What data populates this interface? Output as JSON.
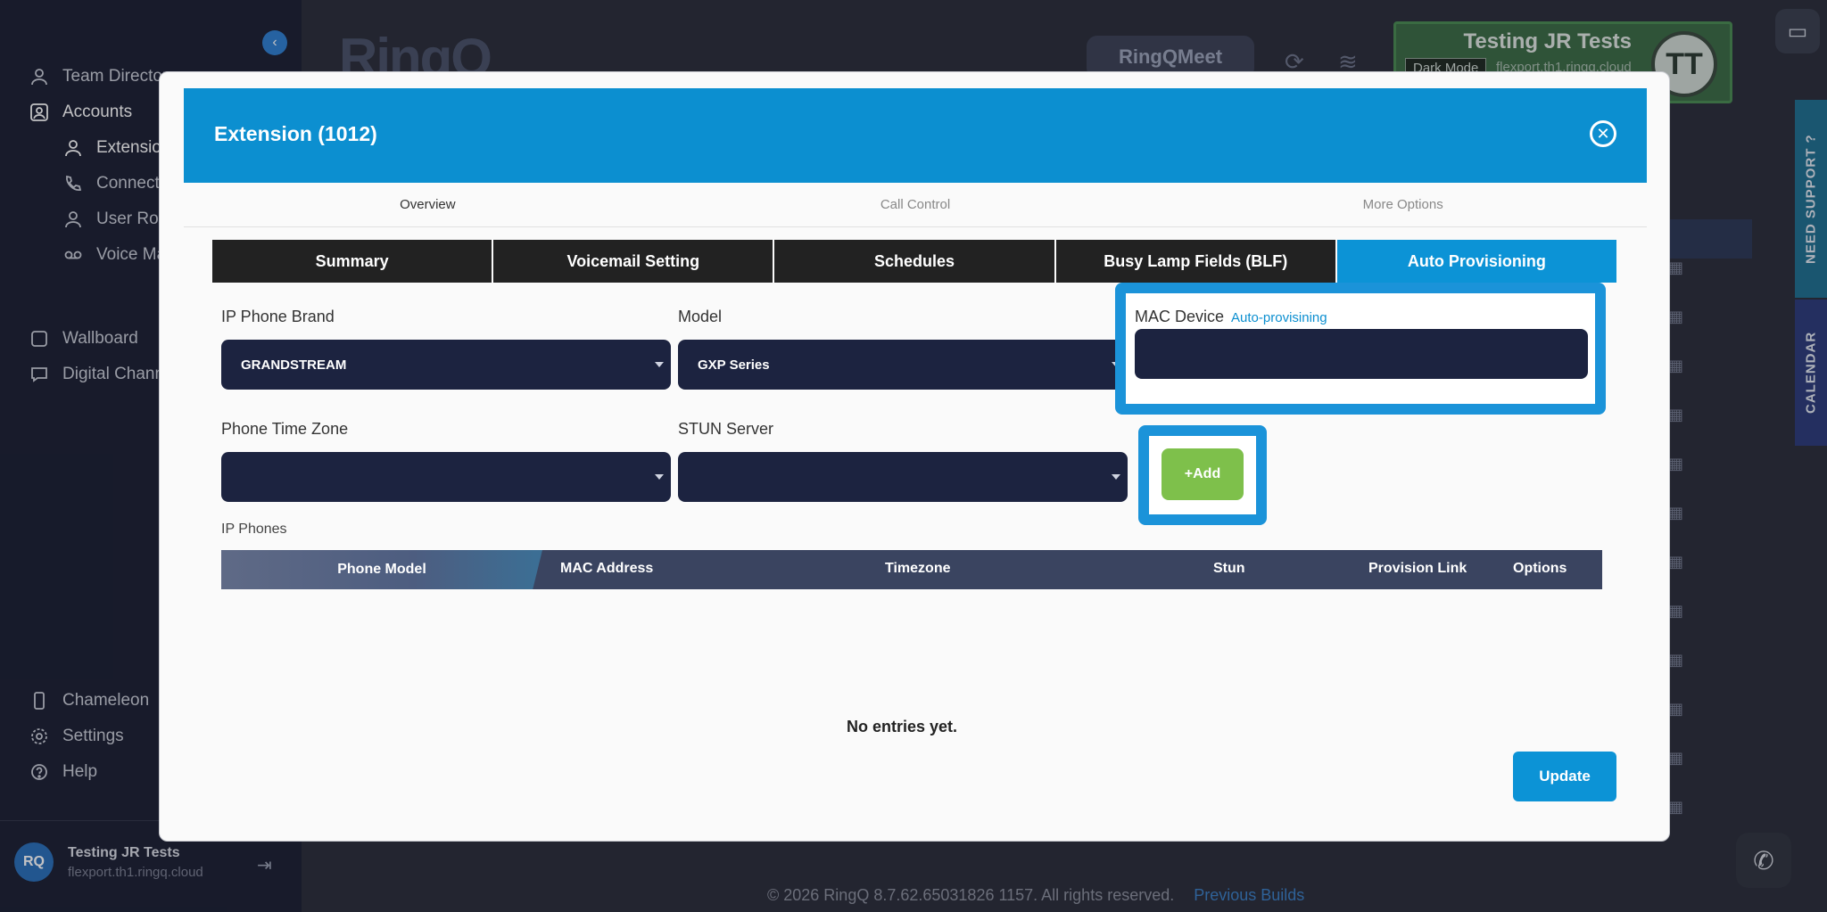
{
  "sidebar": {
    "items": [
      {
        "label": "Team Directory",
        "icon": "user-icon"
      },
      {
        "label": "Accounts",
        "icon": "account-icon"
      },
      {
        "label": "Extensions",
        "icon": "user-icon"
      },
      {
        "label": "Connectors",
        "icon": "phone-icon"
      },
      {
        "label": "User Roles",
        "icon": "user-icon"
      },
      {
        "label": "Voice Mail",
        "icon": "voicemail-icon"
      },
      {
        "label": "Wallboard",
        "icon": "square-icon"
      },
      {
        "label": "Digital Channels",
        "icon": "chat-icon"
      },
      {
        "label": "Chameleon",
        "icon": "device-icon"
      },
      {
        "label": "Settings",
        "icon": "gear-icon"
      },
      {
        "label": "Help",
        "icon": "help-icon"
      }
    ],
    "user": {
      "initials": "RQ",
      "name": "Testing JR Tests",
      "domain": "flexport.th1.ringq.cloud"
    }
  },
  "header": {
    "logo": "RingQ",
    "meet_label": "RingQMeet",
    "user_name": "Testing JR Tests",
    "dark_mode": "Dark Mode",
    "user_domain": "flexport.th1.ringq.cloud",
    "avatar": "TT"
  },
  "side_tabs": {
    "support": "NEED SUPPORT ?",
    "calendar": "CALENDAR"
  },
  "footer": {
    "copyright": "© 2026 RingQ 8.7.62.65031826 1157. All rights reserved.",
    "link": "Previous Builds"
  },
  "modal": {
    "title": "Extension (1012)",
    "top_tabs": [
      "Overview",
      "Call Control",
      "More Options"
    ],
    "sub_tabs": [
      "Summary",
      "Voicemail Setting",
      "Schedules",
      "Busy Lamp Fields (BLF)",
      "Auto Provisioning"
    ],
    "fields": {
      "brand_label": "IP Phone Brand",
      "brand_value": "GRANDSTREAM",
      "model_label": "Model",
      "model_value": "GXP Series",
      "mac_label": "MAC Device",
      "mac_sub": "Auto-provisining",
      "timezone_label": "Phone Time Zone",
      "stun_label": "STUN Server"
    },
    "add_label": "+Add",
    "ip_phones_label": "IP Phones",
    "table_columns": [
      "Phone Model",
      "MAC Address",
      "Timezone",
      "Stun",
      "Provision Link",
      "Options"
    ],
    "empty_message": "No entries yet.",
    "update_label": "Update"
  },
  "colors": {
    "header": "#0c8fd0",
    "active_tab": "#0c93d6",
    "select_bg": "#1c2340",
    "add_button": "#7ec04b",
    "highlight": "#1b93d9"
  }
}
